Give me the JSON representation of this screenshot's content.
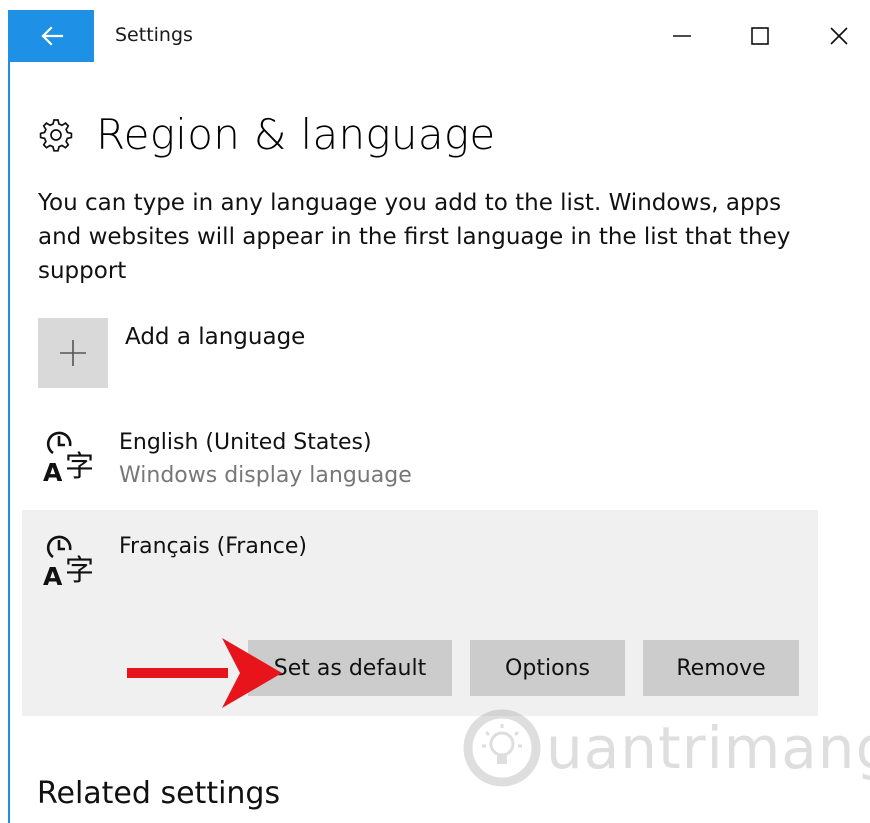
{
  "window": {
    "title": "Settings",
    "accent_color": "#1e90e6"
  },
  "page": {
    "title": "Region & language",
    "description": "You can type in any language you add to the list. Windows, apps and websites will appear in the first language in the list that they support"
  },
  "add_language": {
    "label": "Add a language",
    "icon": "plus-icon"
  },
  "languages": [
    {
      "name": "English (United States)",
      "subtitle": "Windows display language",
      "icon": "language-icon",
      "selected": false
    },
    {
      "name": "Français (France)",
      "subtitle": "",
      "icon": "language-icon",
      "selected": true,
      "actions": [
        "Set as default",
        "Options",
        "Remove"
      ]
    }
  ],
  "related_settings": {
    "title": "Related settings"
  },
  "watermark": {
    "text": "uantrimang"
  }
}
